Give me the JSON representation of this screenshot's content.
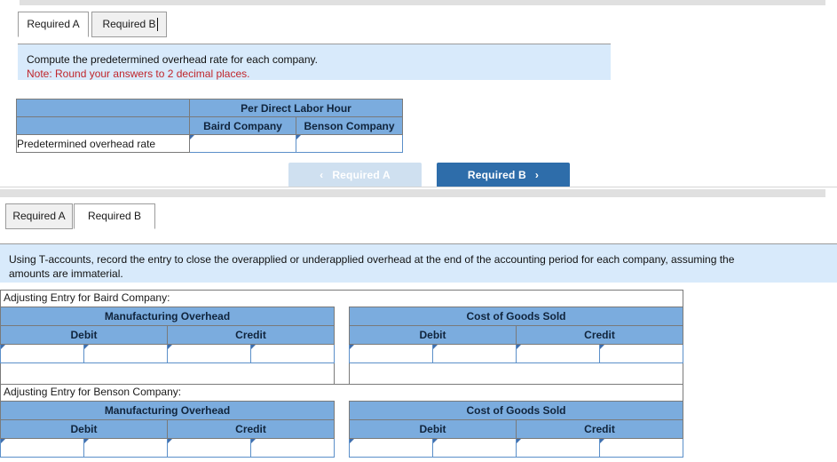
{
  "colors": {
    "header_blue": "#7bacde",
    "question_bg": "#d8eafb",
    "note_red": "#c0262c",
    "primary_button": "#2e6daa",
    "disabled_button": "#cfe0f0",
    "input_border": "#5b8fc9"
  },
  "panel_a": {
    "tabs": [
      {
        "label": "Required A",
        "active": true
      },
      {
        "label": "Required B",
        "active": false
      }
    ],
    "question": {
      "line1": "Compute the predetermined overhead rate for each company.",
      "note": "Note: Round your answers to 2 decimal places."
    },
    "table": {
      "corner_label": "",
      "group_header": "Per Direct Labor Hour",
      "column_headers": [
        "Baird Company",
        "Benson Company"
      ],
      "rows": [
        {
          "label": "Predetermined overhead rate",
          "values": [
            "",
            ""
          ]
        }
      ]
    },
    "nav": {
      "prev_label": "Required A",
      "prev_chevron": "‹",
      "next_label": "Required B",
      "next_chevron": "›"
    }
  },
  "panel_b": {
    "tabs": [
      {
        "label": "Required A",
        "active": false
      },
      {
        "label": "Required B",
        "active": true
      }
    ],
    "question": {
      "line1": "Using T-accounts, record the entry to close the overapplied or underapplied overhead at the end of the accounting period for each company, assuming the",
      "line2": "amounts are immaterial."
    },
    "entries": [
      {
        "title": "Adjusting Entry for Baird Company:",
        "accounts": [
          {
            "name": "Manufacturing Overhead",
            "columns": [
              "Debit",
              "Credit"
            ],
            "rows": [
              {
                "debit": [
                  "",
                  ""
                ],
                "credit": [
                  "",
                  ""
                ]
              }
            ]
          },
          {
            "name": "Cost of Goods Sold",
            "columns": [
              "Debit",
              "Credit"
            ],
            "rows": [
              {
                "debit": [
                  "",
                  ""
                ],
                "credit": [
                  "",
                  ""
                ]
              }
            ]
          }
        ]
      },
      {
        "title": "Adjusting Entry for Benson Company:",
        "accounts": [
          {
            "name": "Manufacturing Overhead",
            "columns": [
              "Debit",
              "Credit"
            ],
            "rows": [
              {
                "debit": [
                  "",
                  ""
                ],
                "credit": [
                  "",
                  ""
                ]
              }
            ]
          },
          {
            "name": "Cost of Goods Sold",
            "columns": [
              "Debit",
              "Credit"
            ],
            "rows": [
              {
                "debit": [
                  "",
                  ""
                ],
                "credit": [
                  "",
                  ""
                ]
              }
            ]
          }
        ]
      }
    ]
  }
}
